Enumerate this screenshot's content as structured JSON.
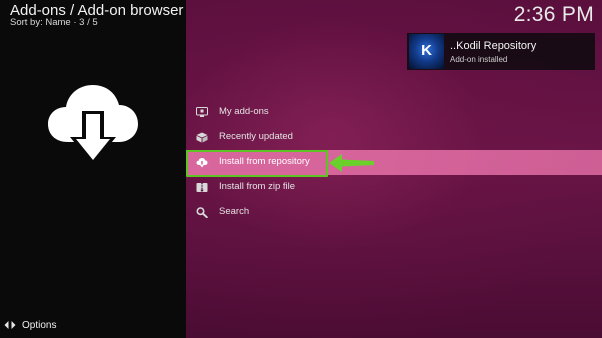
{
  "header": {
    "title": "Add-ons / Add-on browser",
    "subtitle": "Sort by: Name  ·  3 / 5"
  },
  "clock": "2:36 PM",
  "notification": {
    "title": "..Kodil  Repository",
    "message": "Add-on installed",
    "thumb_letter": "K"
  },
  "menu": {
    "items": [
      {
        "label": "My add-ons",
        "icon": "monitor-icon"
      },
      {
        "label": "Recently updated",
        "icon": "box-icon"
      },
      {
        "label": "Install from repository",
        "icon": "cloud-download-icon"
      },
      {
        "label": "Install from zip file",
        "icon": "zip-icon"
      },
      {
        "label": "Search",
        "icon": "search-icon"
      }
    ],
    "selected_index": 2
  },
  "footer": {
    "options_label": "Options"
  },
  "colors": {
    "accent_pink": "#e06ea5",
    "highlight_green": "#5ec424",
    "background": "#5a0f3d"
  }
}
